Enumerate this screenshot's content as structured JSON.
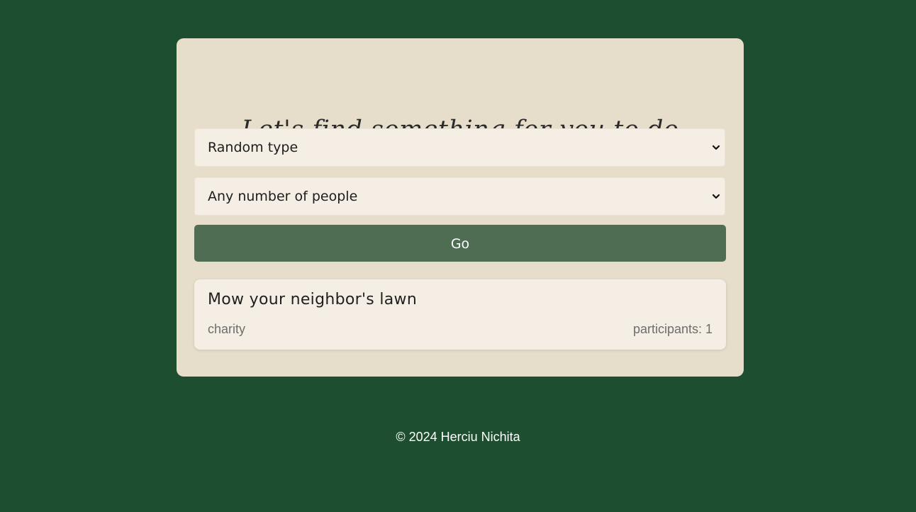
{
  "page": {
    "background_color": "#1c4e2f",
    "card_color": "#e6decb",
    "accent_color": "#4f6d53"
  },
  "header": {
    "title": "Let's find something for you to do"
  },
  "filters": {
    "type_select": {
      "selected": "Random type",
      "icon": "chevron-down-icon"
    },
    "participants_select": {
      "selected": "Any number of people",
      "icon": "chevron-down-icon"
    },
    "go_label": "Go"
  },
  "result": {
    "activity": "Mow your neighbor's lawn",
    "type": "charity",
    "participants": "participants: 1"
  },
  "footer": {
    "text": "© 2024 Herciu Nichita"
  }
}
